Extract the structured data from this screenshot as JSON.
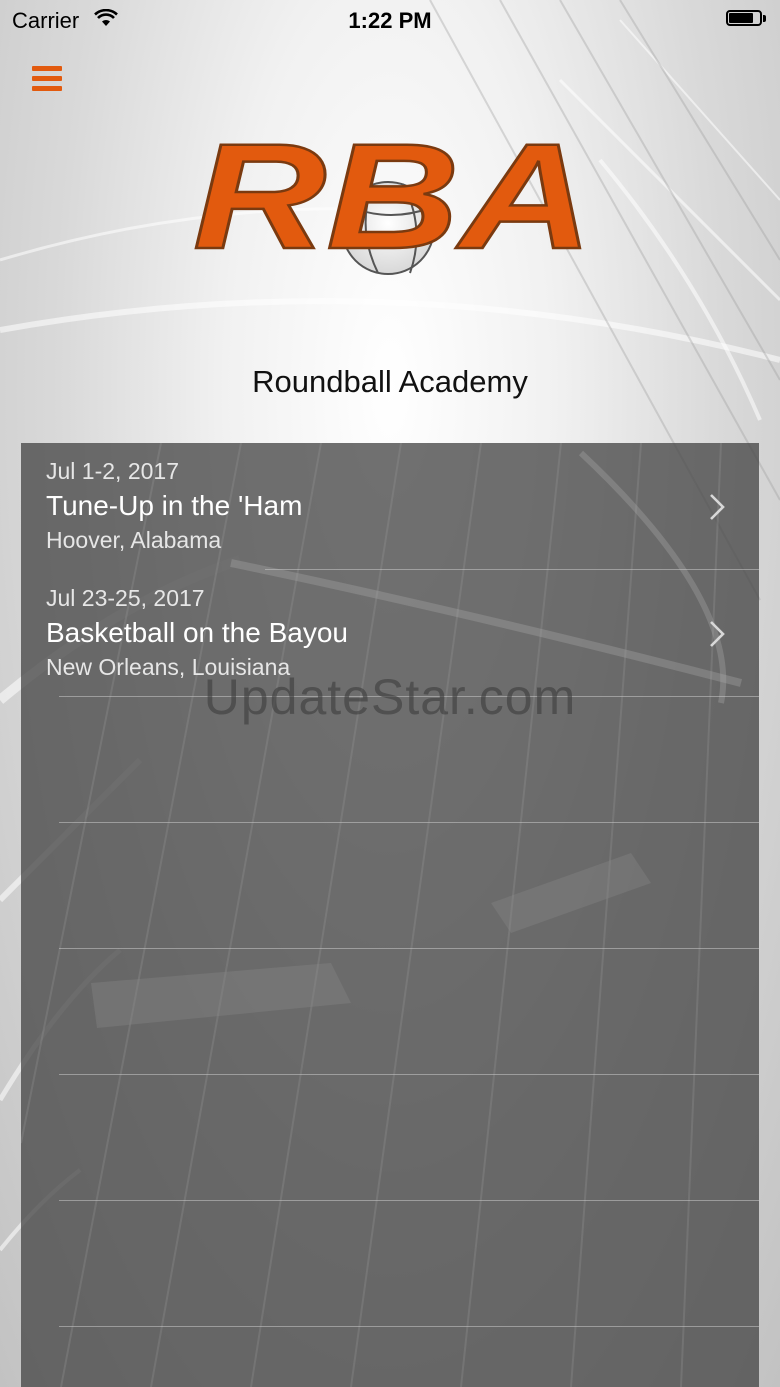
{
  "status_bar": {
    "carrier": "Carrier",
    "time": "1:22 PM"
  },
  "header": {
    "menu_icon": "hamburger-menu-icon",
    "logo_text": "RBA",
    "organization_name": "Roundball Academy"
  },
  "events": [
    {
      "date": "Jul 1-2, 2017",
      "title": "Tune-Up in the 'Ham",
      "location": "Hoover, Alabama"
    },
    {
      "date": "Jul 23-25, 2017",
      "title": "Basketball on the Bayou",
      "location": "New Orleans, Louisiana"
    }
  ],
  "watermark": "UpdateStar.com",
  "colors": {
    "accent": "#e25a0e",
    "panel": "#484848",
    "text_on_panel": "#ffffff"
  }
}
